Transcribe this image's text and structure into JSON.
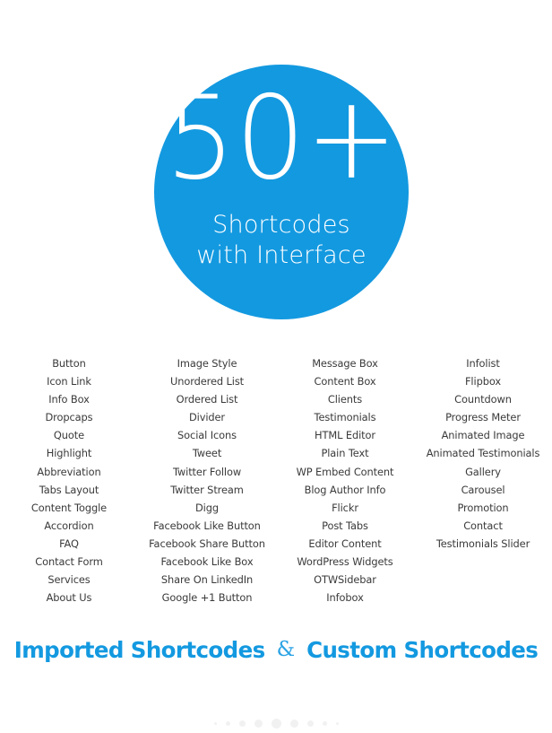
{
  "hero": {
    "count": "50+",
    "subtitle_line1": "Shortcodes",
    "subtitle_line2": "with Interface",
    "circle_color": "#1399e0",
    "text_color": "#ffffff"
  },
  "columns": [
    {
      "name": "column-1",
      "items": [
        "Button",
        "Icon Link",
        "Info Box",
        "Dropcaps",
        "Quote",
        "Highlight",
        "Abbreviation",
        "Tabs Layout",
        "Content Toggle",
        "Accordion",
        "FAQ",
        "Contact Form",
        "Services",
        "About Us"
      ]
    },
    {
      "name": "column-2",
      "items": [
        "Image Style",
        "Unordered List",
        "Ordered List",
        "Divider",
        "Social Icons",
        "Tweet",
        "Twitter Follow",
        "Twitter Stream",
        "Digg",
        "Facebook Like Button",
        "Facebook Share Button",
        "Facebook Like Box",
        "Share On LinkedIn",
        "Google +1 Button"
      ]
    },
    {
      "name": "column-3",
      "items": [
        "Message Box",
        "Content Box",
        "Clients",
        "Testimonials",
        "HTML Editor",
        "Plain Text",
        "WP Embed Content",
        "Blog Author Info",
        "Flickr",
        "Post Tabs",
        "Editor Content",
        "WordPress Widgets",
        "OTWSidebar",
        "Infobox"
      ]
    },
    {
      "name": "column-4",
      "items": [
        "Infolist",
        "Flipbox",
        "Countdown",
        "Progress Meter",
        "Animated Image",
        "Animated Testimonials",
        "Gallery",
        "Carousel",
        "Promotion",
        "Contact",
        "Testimonials Slider"
      ]
    }
  ],
  "footer": {
    "left_heading": "Imported Shortcodes",
    "separator": "&",
    "right_heading": "Custom Shortcodes",
    "heading_color": "#1399e0"
  },
  "dots": {
    "color": "#f1f1f1",
    "sizes": [
      3,
      5,
      7,
      9,
      11,
      9,
      7,
      5,
      3
    ]
  }
}
